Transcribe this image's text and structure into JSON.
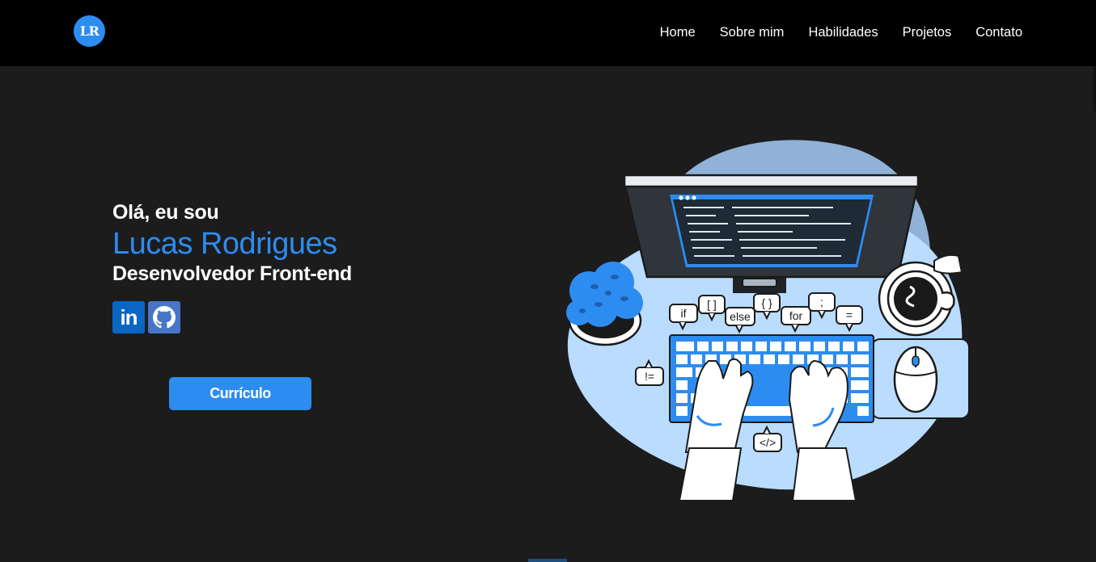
{
  "navbar": {
    "logo_text": "LR",
    "links": [
      {
        "label": "Home"
      },
      {
        "label": "Sobre mim"
      },
      {
        "label": "Habilidades"
      },
      {
        "label": "Projetos"
      },
      {
        "label": "Contato"
      }
    ]
  },
  "hero": {
    "greeting": "Olá, eu sou",
    "name": "Lucas Rodrigues",
    "role": "Desenvolvedor Front-end",
    "social": [
      {
        "icon": "linkedin-icon",
        "label": "in"
      },
      {
        "icon": "github-icon"
      }
    ],
    "cv_button": "Currículo"
  },
  "illustration": {
    "code_bubbles": [
      "if",
      "[ ]",
      "else",
      "{ }",
      "for",
      ";",
      "=",
      "!=",
      "</>"
    ]
  },
  "colors": {
    "accent": "#2d8cf0",
    "navbar_bg": "#000000",
    "page_bg": "#1c1c1d",
    "illustration_blob": "#b9dcff",
    "illustration_dark_blob": "#8fb2d6"
  }
}
